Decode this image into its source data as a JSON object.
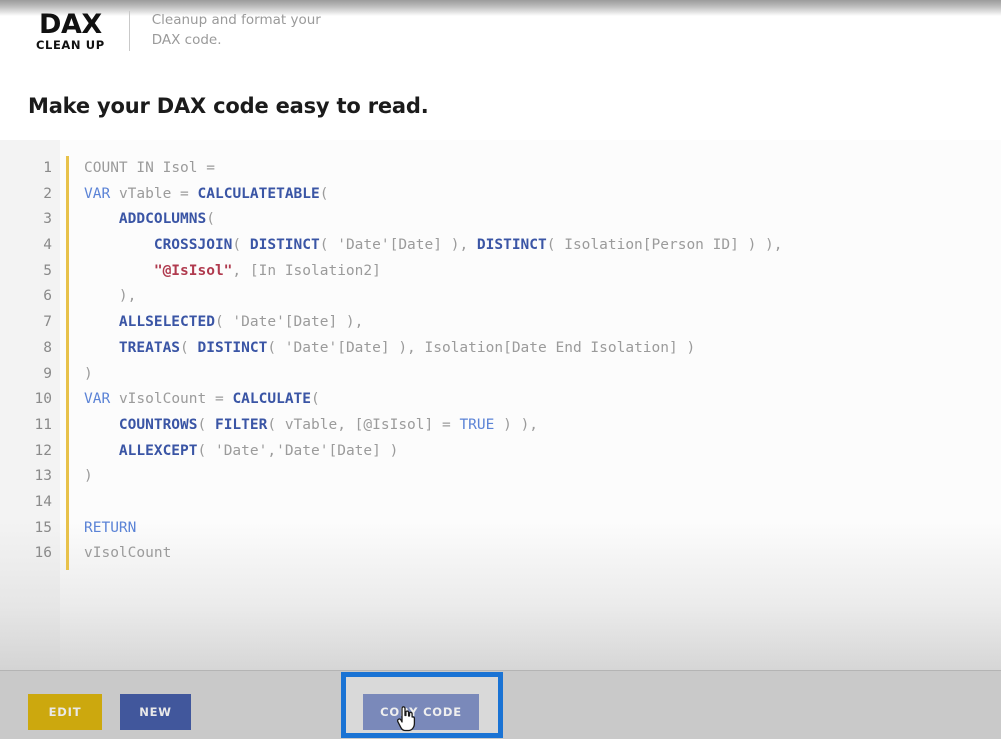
{
  "header": {
    "logo_main": "DAX",
    "logo_sub": "CLEAN UP",
    "tagline": "Cleanup and format your DAX code."
  },
  "page_title": "Make your DAX code easy to read.",
  "editor": {
    "line_numbers": [
      "1",
      "2",
      "3",
      "4",
      "5",
      "6",
      "7",
      "8",
      "9",
      "10",
      "11",
      "12",
      "13",
      "14",
      "15",
      "16"
    ],
    "lines": [
      {
        "n": "1",
        "text": "COUNT IN Isol ="
      },
      {
        "n": "2",
        "text": "VAR vTable = CALCULATETABLE("
      },
      {
        "n": "3",
        "text": "    ADDCOLUMNS("
      },
      {
        "n": "4",
        "text": "        CROSSJOIN( DISTINCT( 'Date'[Date] ), DISTINCT( Isolation[Person ID] ) ),"
      },
      {
        "n": "5",
        "text": "        \"@IsIsol\", [In Isolation2]"
      },
      {
        "n": "6",
        "text": "    ),"
      },
      {
        "n": "7",
        "text": "    ALLSELECTED( 'Date'[Date] ),"
      },
      {
        "n": "8",
        "text": "    TREATAS( DISTINCT( 'Date'[Date] ), Isolation[Date End Isolation] )"
      },
      {
        "n": "9",
        "text": ")"
      },
      {
        "n": "10",
        "text": "VAR vIsolCount = CALCULATE("
      },
      {
        "n": "11",
        "text": "    COUNTROWS( FILTER( vTable, [@IsIsol] = TRUE ) ),"
      },
      {
        "n": "12",
        "text": "    ALLEXCEPT( 'Date','Date'[Date] )"
      },
      {
        "n": "13",
        "text": ")"
      },
      {
        "n": "14",
        "text": ""
      },
      {
        "n": "15",
        "text": "RETURN"
      },
      {
        "n": "16",
        "text": "vIsolCount"
      }
    ],
    "keywords": [
      "VAR",
      "RETURN",
      "TRUE"
    ],
    "functions": [
      "CALCULATETABLE",
      "ADDCOLUMNS",
      "CROSSJOIN",
      "DISTINCT",
      "ALLSELECTED",
      "TREATAS",
      "CALCULATE",
      "COUNTROWS",
      "FILTER",
      "ALLEXCEPT"
    ],
    "strings": [
      "\"@IsIsol\""
    ]
  },
  "toolbar": {
    "edit_label": "EDIT",
    "new_label": "NEW",
    "copy_label": "COPY CODE"
  },
  "colors": {
    "edit_button": "#cca80e",
    "new_button": "#41579c",
    "copy_button": "#41579c",
    "focus_ring": "#1a73d4",
    "gutter_bar": "#e8c24b",
    "keyword": "#5b83d6",
    "function": "#3a55a5",
    "string": "#b03a4e",
    "plain_code": "#9b9b9b"
  }
}
